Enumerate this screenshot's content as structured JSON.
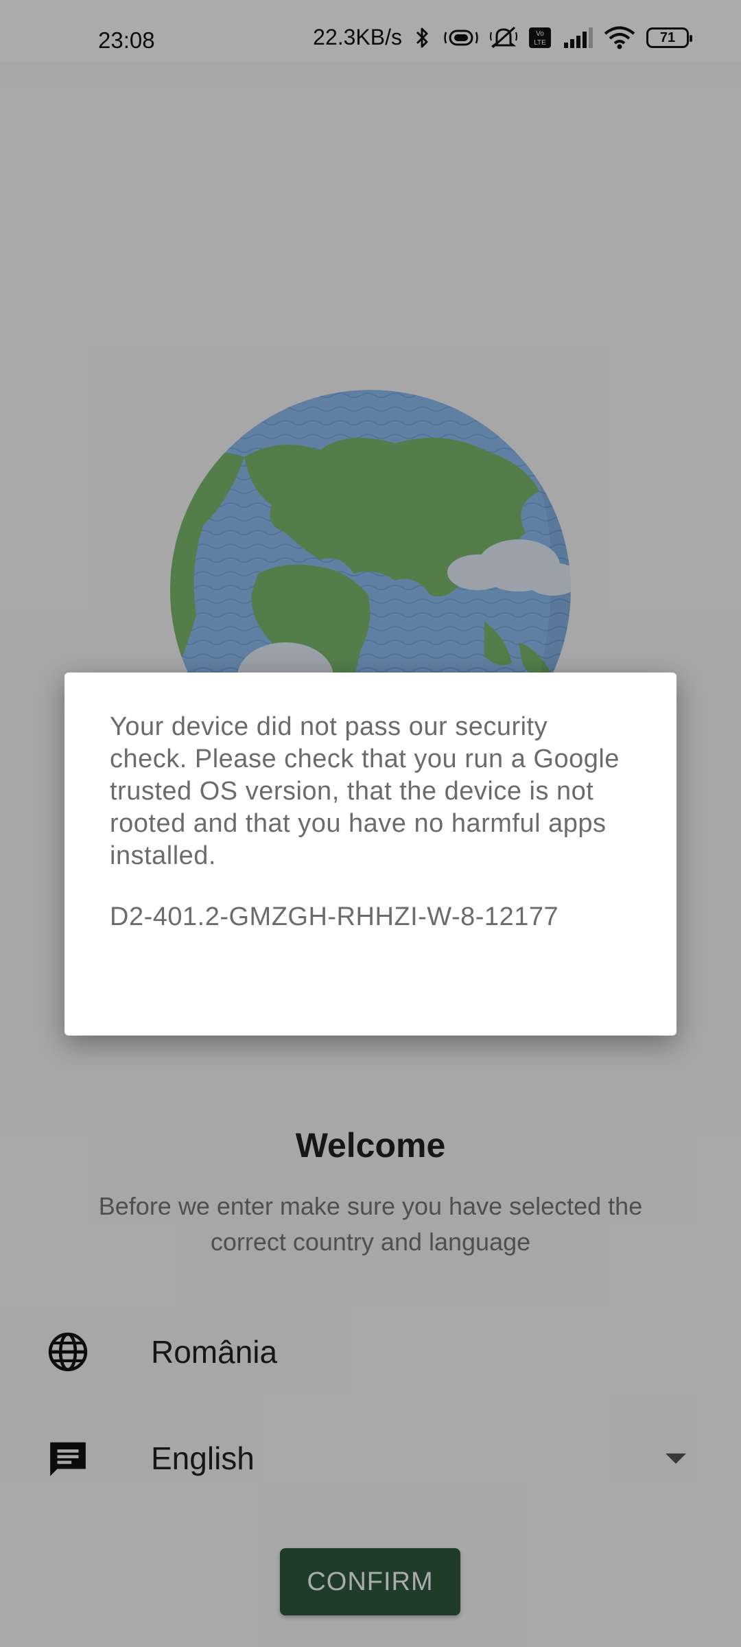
{
  "status_bar": {
    "time": "23:08",
    "net_speed": "22.3KB/s",
    "battery": "71",
    "icons": [
      "bluetooth-icon",
      "vibrate-icon",
      "mute-icon",
      "volte-icon",
      "signal-icon",
      "wifi-icon",
      "battery-icon"
    ]
  },
  "welcome": {
    "title": "Welcome",
    "description": "Before we enter make sure you have selected the correct country and language"
  },
  "country": {
    "icon": "globe-icon",
    "value": "România"
  },
  "language": {
    "icon": "chat-icon",
    "value": "English"
  },
  "confirm_label": "CONFIRM",
  "dialog": {
    "message": "Your device did not pass our security check. Please check that you run a Google trusted OS version, that the device is not rooted and that you have no harmful apps installed.",
    "code": "D2-401.2-GMZGH-RHHZI-W-8-12177"
  },
  "colors": {
    "accent": "#2e5a3d",
    "ocean": "#8fbff4",
    "land": "#7dbd6f"
  }
}
